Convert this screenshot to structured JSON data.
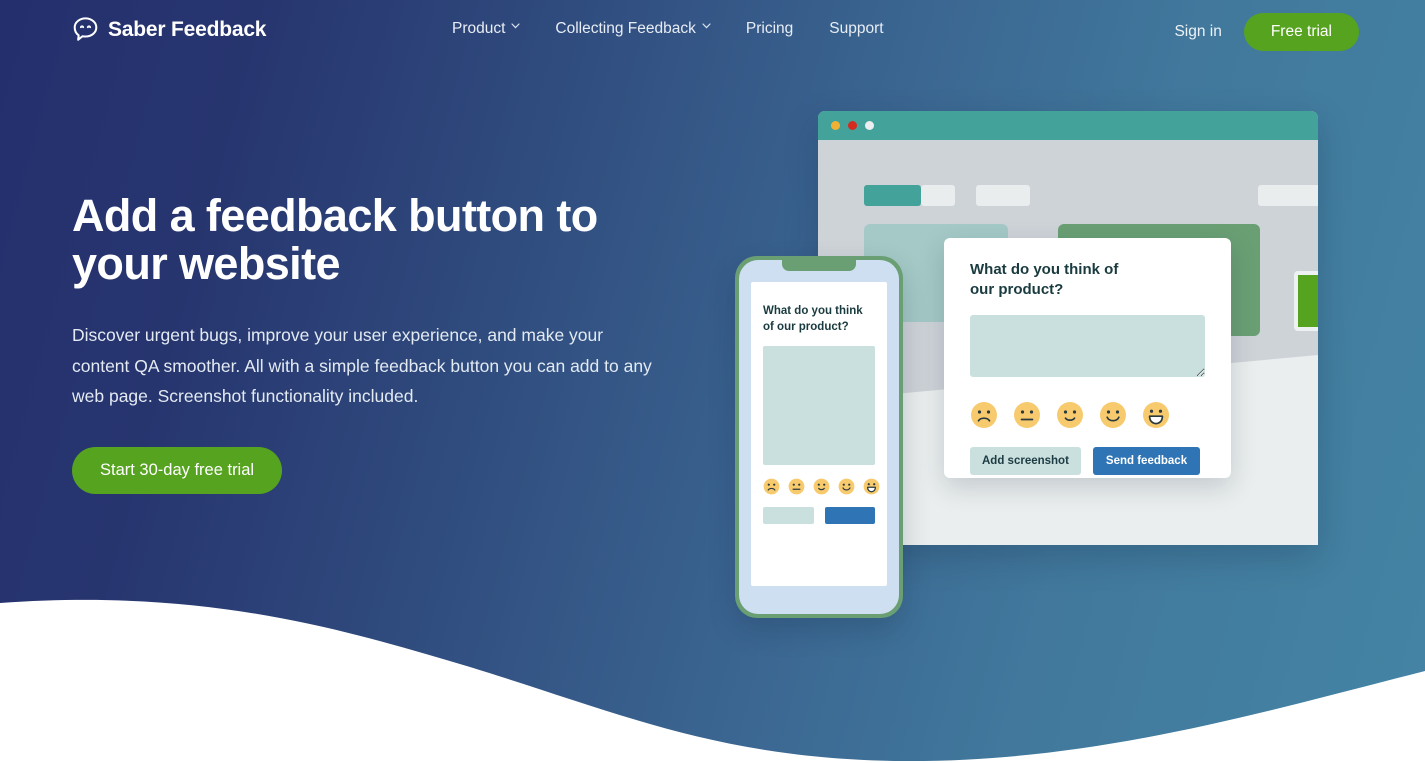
{
  "brand": {
    "name": "Saber Feedback",
    "logo_icon": "speech-bubble-smiley-icon",
    "accent_green": "#56a320",
    "accent_teal": "#43a39a",
    "accent_blue": "#2f74b5",
    "bg_gradient_from": "#24306e",
    "bg_gradient_to": "#4484a4"
  },
  "nav": {
    "items": [
      {
        "label": "Product",
        "has_dropdown": true,
        "icon": "chevron-down-icon"
      },
      {
        "label": "Collecting Feedback",
        "has_dropdown": true,
        "icon": "chevron-down-icon"
      },
      {
        "label": "Pricing",
        "has_dropdown": false
      },
      {
        "label": "Support",
        "has_dropdown": false
      }
    ],
    "sign_in": "Sign in",
    "free_trial": "Free trial"
  },
  "hero": {
    "title": "Add a feedback button to your website",
    "subtitle": "Discover urgent bugs, improve your user experience, and make your content QA smoother. All with a simple feedback button you can add to any web page. Screenshot functionality included.",
    "cta": "Start 30-day free trial"
  },
  "widget": {
    "title": "What do you think of\nour product?",
    "textarea_placeholder": "",
    "textarea_value": "",
    "faces": [
      {
        "name": "face-sad",
        "glyph": "sad"
      },
      {
        "name": "face-neutral",
        "glyph": "neutral"
      },
      {
        "name": "face-slight-smile",
        "glyph": "slight-smile"
      },
      {
        "name": "face-smile",
        "glyph": "smile"
      },
      {
        "name": "face-grin",
        "glyph": "grin"
      }
    ],
    "add_screenshot": "Add screenshot",
    "send_feedback": "Send feedback"
  },
  "phone_widget": {
    "title": "What do you think\nof our product?"
  },
  "browser_mock": {
    "dots": [
      "yellow",
      "red",
      "white"
    ],
    "feedback_tab_color": "#56a320"
  }
}
